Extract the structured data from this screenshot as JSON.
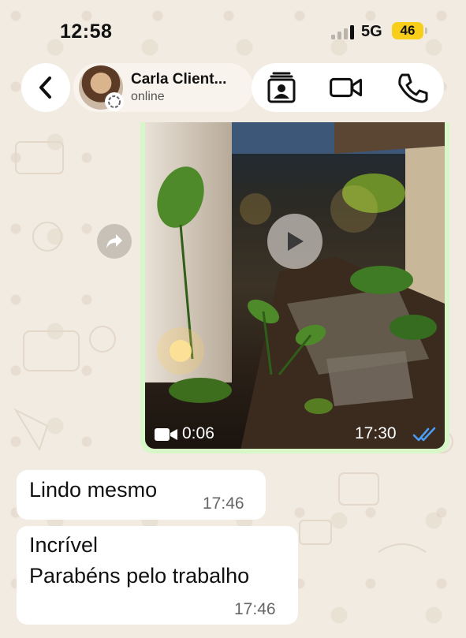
{
  "status_bar": {
    "time": "12:58",
    "network": "5G",
    "battery": "46"
  },
  "header": {
    "contact_name": "Carla Client...",
    "contact_status": "online"
  },
  "video_message": {
    "duration": "0:06",
    "time": "17:30"
  },
  "messages": [
    {
      "lines": [
        "Lindo mesmo"
      ],
      "time": "17:46"
    },
    {
      "lines": [
        "Incrível",
        "Parabéns pelo trabalho"
      ],
      "time": "17:46"
    }
  ],
  "colors": {
    "outgoing_bubble": "#d7f7c8",
    "read_ticks": "#4a9cf5",
    "battery": "#f7cf1a"
  }
}
